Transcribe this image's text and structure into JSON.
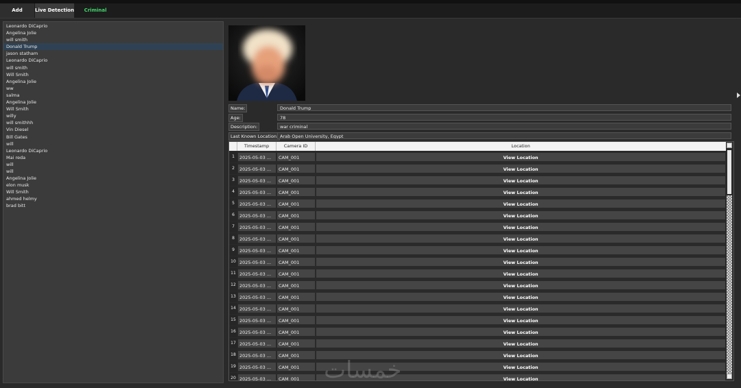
{
  "tabs": [
    {
      "label": "Add Criminal"
    },
    {
      "label": "Live Detection"
    },
    {
      "label": "Criminal Details"
    }
  ],
  "active_tab_color": "#43d66d",
  "names": [
    "Leonardo DiCaprio",
    "Angelina Jolie",
    "will smith",
    "Donald Trump",
    "jason statham",
    "Leonardo DiCaprio",
    "will smith",
    "Will Smith",
    "Angelina Jolie",
    "ww",
    "salma",
    "Angelina Jolie",
    "Will Smith",
    "willy",
    "will smithhh",
    "Vin Diesel",
    "Bill Gates",
    "will",
    "Leonardo DiCaprio",
    "Mai reda",
    "will",
    "will",
    "Angelina Jolie",
    "elon musk",
    "Will Smith",
    "ahmed helmy",
    "brad bitt"
  ],
  "selected_index": 3,
  "details": {
    "name_label": "Name:",
    "name": "Donald Trump",
    "age_label": "Age:",
    "age": "78",
    "description_label": "Description:",
    "description": "war criminal",
    "location_label": "Last Known Location:",
    "location": "Arab Open University, Egypt"
  },
  "table": {
    "headers": [
      "Timestamp",
      "Camera ID",
      "Location"
    ],
    "rows": [
      {
        "n": "1",
        "ts": "2025-05-03 ...",
        "cam": "CAM_001",
        "loc": "View Location"
      },
      {
        "n": "2",
        "ts": "2025-05-03 ...",
        "cam": "CAM_001",
        "loc": "View Location"
      },
      {
        "n": "3",
        "ts": "2025-05-03 ...",
        "cam": "CAM_001",
        "loc": "View Location"
      },
      {
        "n": "4",
        "ts": "2025-05-03 ...",
        "cam": "CAM_001",
        "loc": "View Location"
      },
      {
        "n": "5",
        "ts": "2025-05-03 ...",
        "cam": "CAM_001",
        "loc": "View Location"
      },
      {
        "n": "6",
        "ts": "2025-05-03 ...",
        "cam": "CAM_001",
        "loc": "View Location"
      },
      {
        "n": "7",
        "ts": "2025-05-03 ...",
        "cam": "CAM_001",
        "loc": "View Location"
      },
      {
        "n": "8",
        "ts": "2025-05-03 ...",
        "cam": "CAM_001",
        "loc": "View Location"
      },
      {
        "n": "9",
        "ts": "2025-05-03 ...",
        "cam": "CAM_001",
        "loc": "View Location"
      },
      {
        "n": "10",
        "ts": "2025-05-03 ...",
        "cam": "CAM_001",
        "loc": "View Location"
      },
      {
        "n": "11",
        "ts": "2025-05-03 ...",
        "cam": "CAM_001",
        "loc": "View Location"
      },
      {
        "n": "12",
        "ts": "2025-05-03 ...",
        "cam": "CAM_001",
        "loc": "View Location"
      },
      {
        "n": "13",
        "ts": "2025-05-03 ...",
        "cam": "CAM_001",
        "loc": "View Location"
      },
      {
        "n": "14",
        "ts": "2025-05-03 ...",
        "cam": "CAM_001",
        "loc": "View Location"
      },
      {
        "n": "15",
        "ts": "2025-05-03 ...",
        "cam": "CAM_001",
        "loc": "View Location"
      },
      {
        "n": "16",
        "ts": "2025-05-03 ...",
        "cam": "CAM_001",
        "loc": "View Location"
      },
      {
        "n": "17",
        "ts": "2025-05-03 ...",
        "cam": "CAM_001",
        "loc": "View Location"
      },
      {
        "n": "18",
        "ts": "2025-05-03 ...",
        "cam": "CAM_001",
        "loc": "View Location"
      },
      {
        "n": "19",
        "ts": "2025-05-03 ...",
        "cam": "CAM_001",
        "loc": "View Location"
      },
      {
        "n": "20",
        "ts": "2025-05-03 ...",
        "cam": "CAM_001",
        "loc": "View Location"
      }
    ]
  },
  "watermark": "خمسات"
}
